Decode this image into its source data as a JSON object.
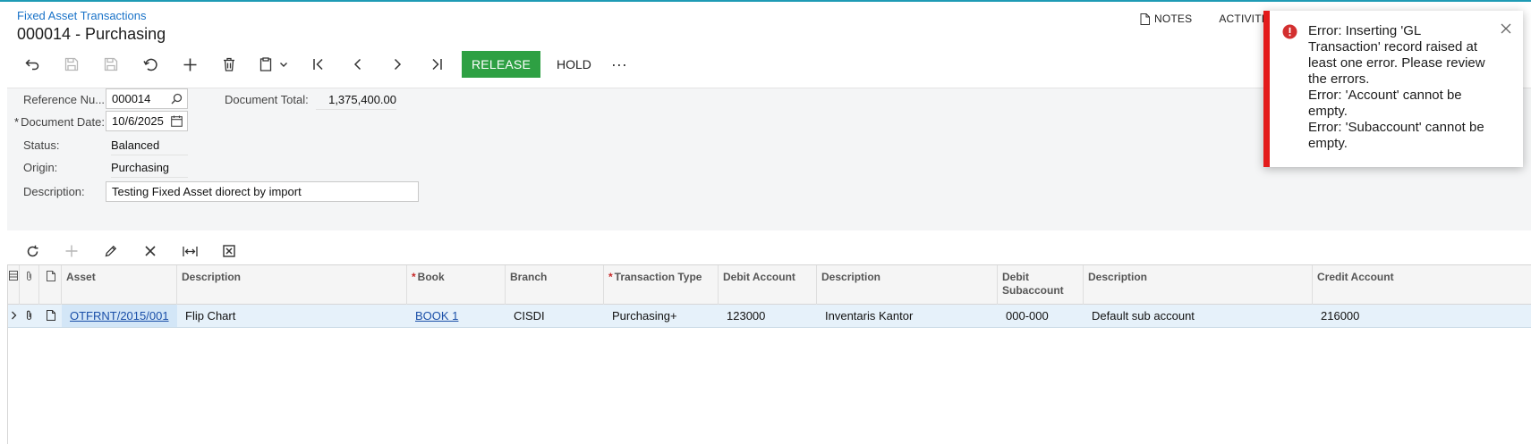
{
  "header": {
    "breadcrumb": "Fixed Asset Transactions",
    "title": "000014 - Purchasing",
    "notes_label": "NOTES",
    "activities_label": "ACTIVITI"
  },
  "toolbar": {
    "release_label": "RELEASE",
    "hold_label": "HOLD",
    "more_label": "···"
  },
  "form": {
    "reference_label": "Reference Nu...",
    "reference_value": "000014",
    "document_total_label": "Document Total:",
    "document_total_value": "1,375,400.00",
    "document_date_label": "Document Date:",
    "document_date_value": "10/6/2025",
    "status_label": "Status:",
    "status_value": "Balanced",
    "origin_label": "Origin:",
    "origin_value": "Purchasing",
    "description_label": "Description:",
    "description_value": "Testing Fixed Asset diorect by import"
  },
  "grid": {
    "columns": {
      "asset": "Asset",
      "description": "Description",
      "book": "Book",
      "branch": "Branch",
      "transaction_type": "Transaction Type",
      "debit_account": "Debit Account",
      "debit_account_description": "Description",
      "debit_subaccount": "Debit Subaccount",
      "debit_subaccount_description": "Description",
      "credit_account": "Credit Account"
    },
    "rows": [
      {
        "asset": "OTFRNT/2015/001",
        "description": "Flip Chart",
        "book": "BOOK 1",
        "branch": "CISDI",
        "transaction_type": "Purchasing+",
        "debit_account": "123000",
        "debit_account_description": "Inventaris Kantor",
        "debit_subaccount": "000-000",
        "debit_subaccount_description": "Default sub account",
        "credit_account": "216000"
      }
    ]
  },
  "toast": {
    "lines": [
      "Error: Inserting  'GL Transaction' record raised at least one error. Please review the errors.",
      "Error: 'Account' cannot be empty.",
      "Error: 'Subaccount' cannot be empty."
    ]
  },
  "colors": {
    "accent": "#1a73c8",
    "release": "#2ea043",
    "error": "#e31b1b",
    "row_selected": "#e6f1fa"
  }
}
